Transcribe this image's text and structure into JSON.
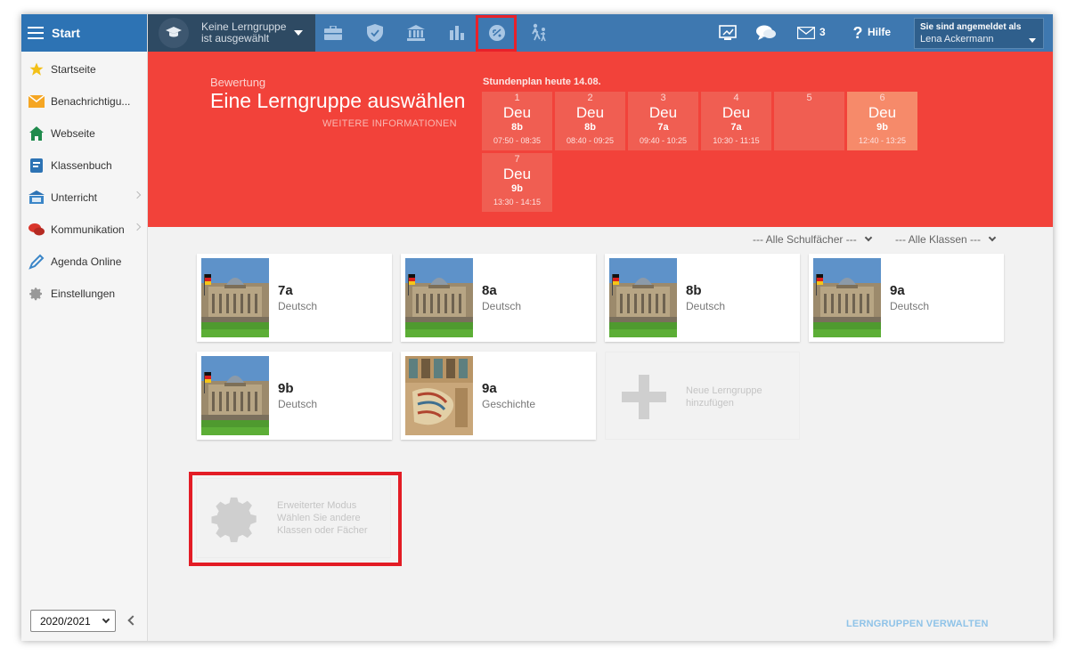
{
  "sidebar": {
    "title": "Start",
    "items": [
      {
        "label": "Startseite",
        "icon": "star-icon"
      },
      {
        "label": "Benachrichtigu...",
        "icon": "mail-icon"
      },
      {
        "label": "Webseite",
        "icon": "home-icon"
      },
      {
        "label": "Klassenbuch",
        "icon": "book-icon"
      },
      {
        "label": "Unterricht",
        "icon": "classroom-icon"
      },
      {
        "label": "Kommunikation",
        "icon": "chat-icon"
      },
      {
        "label": "Agenda Online",
        "icon": "pen-icon"
      },
      {
        "label": "Einstellungen",
        "icon": "gear-icon"
      }
    ],
    "year": "2020/2021"
  },
  "topbar": {
    "group_line1": "Keine Lerngruppe",
    "group_line2": "ist ausgewählt",
    "mail_count": "3",
    "help": "Hilfe",
    "login_line1": "Sie sind angemeldet als",
    "login_user": "Lena Ackermann"
  },
  "banner": {
    "subtitle": "Bewertung",
    "title": "Eine Lerngruppe auswählen",
    "more_info": "WEITERE INFORMATIONEN",
    "schedule_title": "Stundenplan heute 14.08.",
    "slots": [
      {
        "n": "1",
        "subject": "Deu",
        "class": "8b",
        "time": "07:50 - 08:35"
      },
      {
        "n": "2",
        "subject": "Deu",
        "class": "8b",
        "time": "08:40 - 09:25"
      },
      {
        "n": "3",
        "subject": "Deu",
        "class": "7a",
        "time": "09:40 - 10:25"
      },
      {
        "n": "4",
        "subject": "Deu",
        "class": "7a",
        "time": "10:30 - 11:15"
      },
      {
        "n": "5",
        "subject": "",
        "class": "",
        "time": ""
      },
      {
        "n": "6",
        "subject": "Deu",
        "class": "9b",
        "time": "12:40 - 13:25"
      },
      {
        "n": "7",
        "subject": "Deu",
        "class": "9b",
        "time": "13:30 - 14:15"
      }
    ]
  },
  "filters": {
    "subjects": "--- Alle Schulfächer ---",
    "classes": "--- Alle Klassen ---"
  },
  "cards": [
    {
      "cls": "7a",
      "subject": "Deutsch"
    },
    {
      "cls": "8a",
      "subject": "Deutsch"
    },
    {
      "cls": "8b",
      "subject": "Deutsch"
    },
    {
      "cls": "9a",
      "subject": "Deutsch"
    },
    {
      "cls": "9b",
      "subject": "Deutsch"
    },
    {
      "cls": "9a",
      "subject": "Geschichte"
    }
  ],
  "add_card": {
    "line1": "Neue Lerngruppe",
    "line2": "hinzufügen"
  },
  "advanced": {
    "line1": "Erweiterter Modus",
    "line2": "Wählen Sie andere",
    "line3": "Klassen oder Fächer"
  },
  "manage_link": "LERNGRUPPEN VERWALTEN"
}
